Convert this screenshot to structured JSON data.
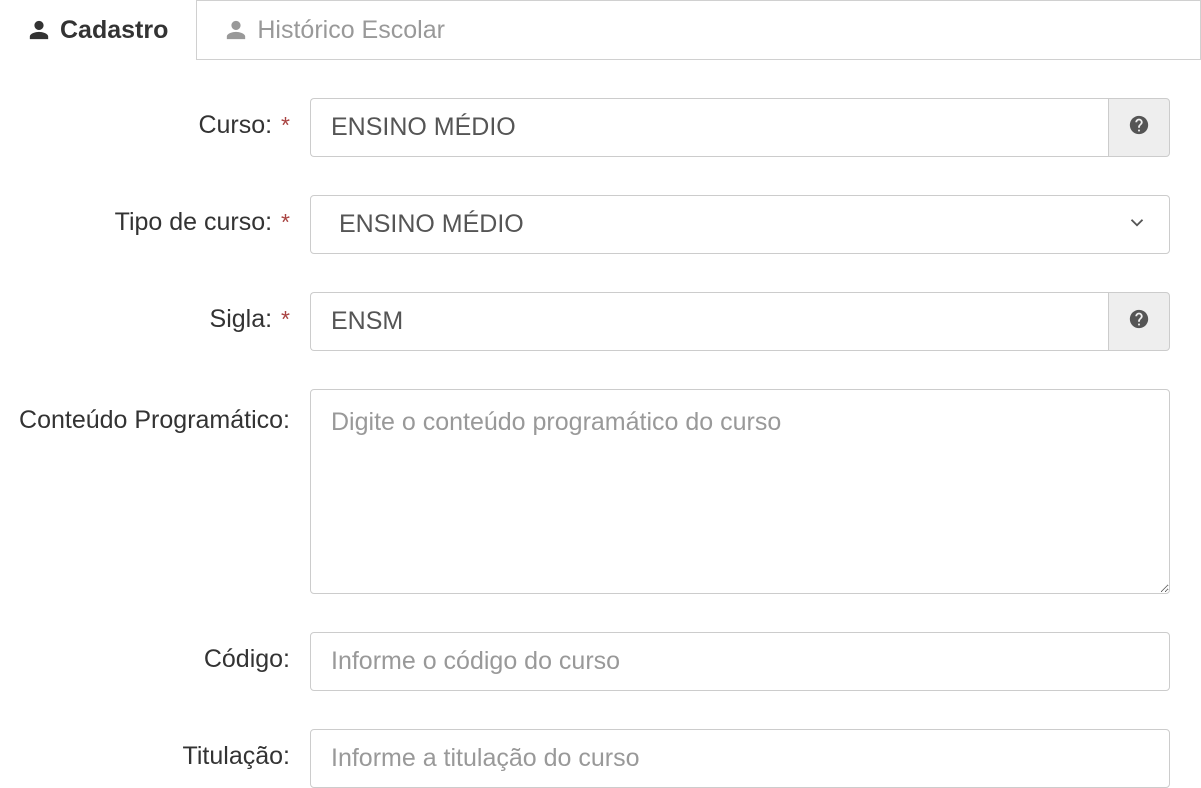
{
  "tabs": {
    "active": "Cadastro",
    "inactive": "Histórico Escolar"
  },
  "form": {
    "curso": {
      "label": "Curso:",
      "value": "ENSINO MÉDIO",
      "required": true
    },
    "tipo_curso": {
      "label": "Tipo de curso:",
      "value": "ENSINO MÉDIO",
      "required": true
    },
    "sigla": {
      "label": "Sigla:",
      "value": "ENSM",
      "required": true
    },
    "conteudo": {
      "label": "Conteúdo Programático:",
      "placeholder": "Digite o conteúdo programático do curso",
      "value": ""
    },
    "codigo": {
      "label": "Código:",
      "placeholder": "Informe o código do curso",
      "value": ""
    },
    "titulacao": {
      "label": "Titulação:",
      "placeholder": "Informe a titulação do curso",
      "value": ""
    }
  },
  "required_marker": "*"
}
